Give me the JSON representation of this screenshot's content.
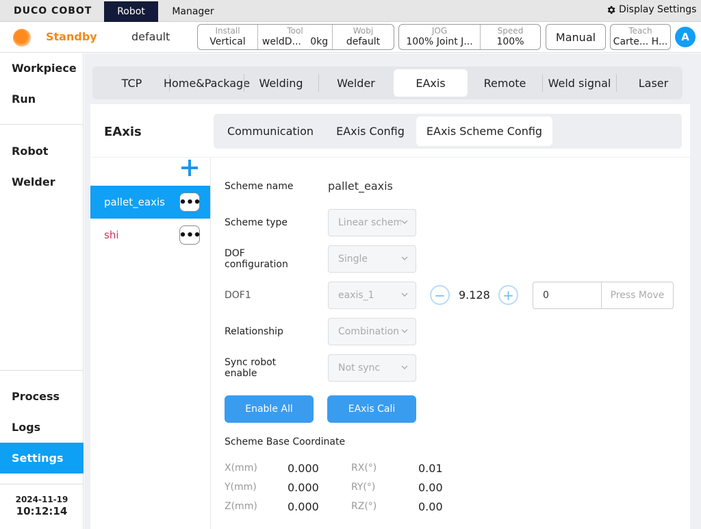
{
  "topbar": {
    "logo": "DUCO COBOT",
    "tabs": [
      {
        "label": "Robot"
      },
      {
        "label": "Manager"
      }
    ],
    "display_settings": "Display Settings"
  },
  "status": {
    "state": "Standby",
    "program": "default",
    "install": {
      "label": "Install",
      "value": "Vertical"
    },
    "tool": {
      "label": "Tool",
      "value": "weldD...",
      "extra": "0kg"
    },
    "wobj": {
      "label": "Wobj",
      "value": "default"
    },
    "jog": {
      "label": "JOG",
      "value": "100% Joint J..."
    },
    "speed": {
      "label": "Speed",
      "value": "100%"
    },
    "mode": "Manual",
    "teach": {
      "label": "Teach",
      "value": "Carte... H..."
    },
    "avatar": "A"
  },
  "sidebar": {
    "items": [
      "Workpiece",
      "Run",
      "Robot",
      "Welder",
      "Process",
      "Logs",
      "Settings"
    ],
    "date": "2024-11-19",
    "time": "10:12:14"
  },
  "primary_tabs": [
    "TCP",
    "Home&Package",
    "Welding",
    "Welder",
    "EAxis",
    "Remote",
    "Weld signal",
    "Laser"
  ],
  "panel": {
    "title": "EAxis",
    "subtabs": [
      "Communication",
      "EAxis Config",
      "EAxis Scheme Config"
    ]
  },
  "schemes": [
    {
      "name": "pallet_eaxis"
    },
    {
      "name": "shi"
    }
  ],
  "form": {
    "scheme_name_label": "Scheme name",
    "scheme_name_value": "pallet_eaxis",
    "scheme_type_label": "Scheme type",
    "scheme_type_value": "Linear schem",
    "dof_config_label": "DOF configuration",
    "dof_config_value": "Single",
    "dof1_label": "DOF1",
    "dof1_select": "eaxis_1",
    "dof1_value": "9.128",
    "move_input": "0",
    "press_move": "Press Move",
    "relationship_label": "Relationship",
    "relationship_value": "Combination",
    "sync_label": "Sync robot enable",
    "sync_value": "Not sync",
    "enable_all": "Enable All",
    "eaxis_cali": "EAxis Cali"
  },
  "coordinates": {
    "title": "Scheme Base Coordinate",
    "x": {
      "label": "X(mm)",
      "value": "0.000"
    },
    "y": {
      "label": "Y(mm)",
      "value": "0.000"
    },
    "z": {
      "label": "Z(mm)",
      "value": "0.000"
    },
    "rx": {
      "label": "RX(°)",
      "value": "0.01"
    },
    "ry": {
      "label": "RY(°)",
      "value": "0.00"
    },
    "rz": {
      "label": "RZ(°)",
      "value": "0.00"
    }
  },
  "colors": {
    "accent": "#0da0f5",
    "status": "#f08a1c",
    "nav_dark": "#141b3a",
    "danger_text": "#d0335a"
  }
}
